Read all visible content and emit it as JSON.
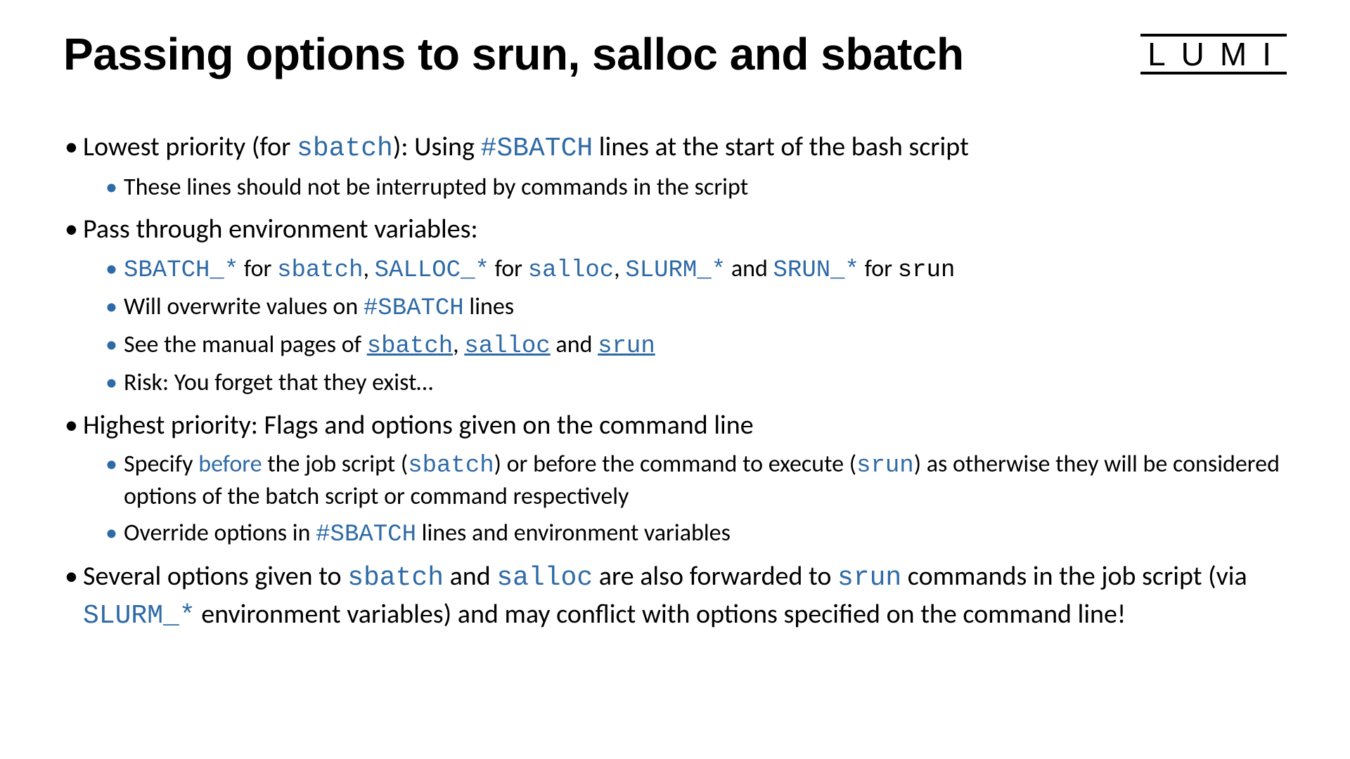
{
  "title": "Passing options to srun, salloc and sbatch",
  "logo": "LUMI",
  "b1": {
    "t1": "Lowest priority (for ",
    "sbatch": "sbatch",
    "t2": "): Using ",
    "hashsbatch": "#SBATCH",
    "t3": " lines at the start of the bash script",
    "sub1": "These lines should not be interrupted by commands in the script"
  },
  "b2": {
    "t1": "Pass through environment variables:",
    "s1": {
      "sbatchstar": "SBATCH_*",
      "t1": " for ",
      "sbatch": "sbatch",
      "t2": ", ",
      "sallocstar": "SALLOC_*",
      "t3": " for ",
      "salloc": "salloc",
      "t4": ", ",
      "slurmstar": "SLURM_*",
      "t5": " and ",
      "srunstar": "SRUN_*",
      "t6": " for ",
      "srun": "srun"
    },
    "s2": {
      "t1": "Will overwrite values on ",
      "hashsbatch": "#SBATCH",
      "t2": " lines"
    },
    "s3": {
      "t1": "See the manual pages of ",
      "sbatch": "sbatch",
      "t2": ", ",
      "salloc": "salloc",
      "t3": " and ",
      "srun": "srun"
    },
    "s4": "Risk: You forget that they exist…"
  },
  "b3": {
    "t1": "Highest priority: Flags and options given on the command line",
    "s1": {
      "t1": "Specify ",
      "before": "before",
      "t2": " the job script (",
      "sbatch": "sbatch",
      "t3": ") or before the command to execute (",
      "srun": "srun",
      "t4": ") as otherwise they will be considered options of the batch script or command respectively"
    },
    "s2": {
      "t1": "Override options in ",
      "hashsbatch": "#SBATCH",
      "t2": " lines and environment variables"
    }
  },
  "b4": {
    "t1": "Several options given to ",
    "sbatch": "sbatch",
    "t2": " and ",
    "salloc": "salloc",
    "t3": " are also forwarded to ",
    "srun": "srun",
    "t4": " commands in the job script (via ",
    "slurmstar": "SLURM_*",
    "t5": " environment variables) and may conflict with options specified on the command line!"
  }
}
